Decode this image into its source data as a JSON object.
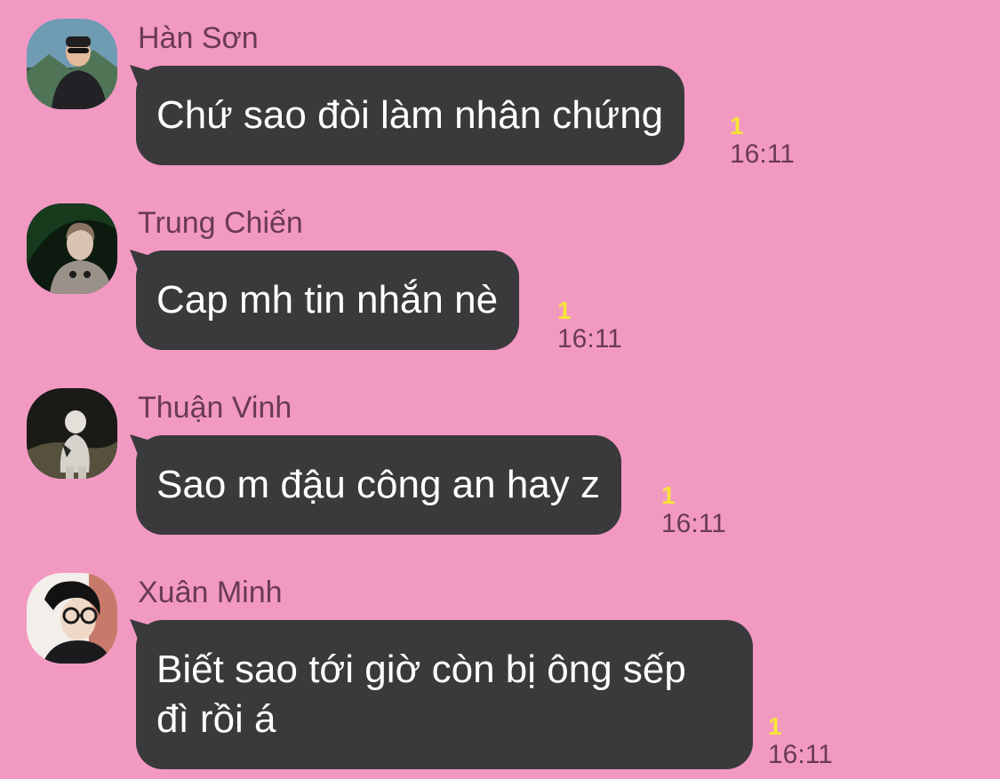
{
  "colors": {
    "background": "#f299c2",
    "bubble": "#3a393b",
    "bubble_text": "#ffffff",
    "sender_text": "#6a3a55",
    "unread_count": "#f7e43a"
  },
  "messages": [
    {
      "sender": "Hàn Sơn",
      "avatar": "avatar-han-son",
      "text": "Chứ sao đòi làm nhân chứng",
      "unread": "1",
      "time": "16:11"
    },
    {
      "sender": "Trung Chiến",
      "avatar": "avatar-trung-chien",
      "text": "Cap mh tin nhắn nè",
      "unread": "1",
      "time": "16:11"
    },
    {
      "sender": "Thuận Vinh",
      "avatar": "avatar-thuan-vinh",
      "text": "Sao m đậu công an hay z",
      "unread": "1",
      "time": "16:11"
    },
    {
      "sender": "Xuân Minh",
      "avatar": "avatar-xuan-minh",
      "text_line1": "Biết sao tới giờ còn bị ông sếp",
      "text_line2": "đì rồi á",
      "unread": "1",
      "time": "16:11"
    }
  ]
}
